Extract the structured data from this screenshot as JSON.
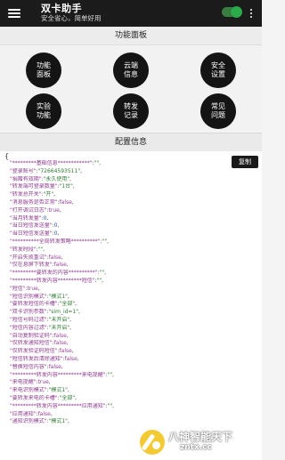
{
  "toolbar": {
    "title": "双卡助手",
    "subtitle": "安全省心，简单好用",
    "toggle_on": true,
    "accent_color": "#2ca94b"
  },
  "panel": {
    "header": "功能面板",
    "buttons": [
      {
        "label": "功能面板"
      },
      {
        "label": "云端信息"
      },
      {
        "label": "安全设置"
      },
      {
        "label": "实验功能"
      },
      {
        "label": "转发记录"
      },
      {
        "label": "常见问题"
      }
    ]
  },
  "config": {
    "header": "配置信息",
    "brace_open": "{",
    "copy_label": "复制",
    "lines": [
      {
        "key": "\"*********基础信息************\"",
        "value": "\"\"",
        "type": "s"
      },
      {
        "key": "\"登录账号\"",
        "value": "\"72664593511\"",
        "type": "s"
      },
      {
        "key": "\"捐赠有效期\"",
        "value": "\"永久使用\"",
        "type": "s"
      },
      {
        "key": "\"转发端可登录数量\"",
        "value": "\"1台\"",
        "type": "s"
      },
      {
        "key": "\"转发总开关\"",
        "value": "\"开\"",
        "type": "s"
      },
      {
        "key": "\"消息服务是否正常\"",
        "value": "false",
        "type": "b"
      },
      {
        "key": "\"打开调试日志\"",
        "value": "true",
        "type": "b"
      },
      {
        "key": "\"当月转发量\"",
        "value": "0",
        "type": "n"
      },
      {
        "key": "\"当日短信发送量\"",
        "value": "0",
        "type": "n"
      },
      {
        "key": "\"当日短信发送量\"",
        "value": "0",
        "type": "n"
      },
      {
        "key": "\"**********全局转发策略**********\"",
        "value": "\"\"",
        "type": "s"
      },
      {
        "key": "\"转发时段\"",
        "value": "\"\"",
        "type": "s"
      },
      {
        "key": "\"开启失败重试\"",
        "value": "false",
        "type": "b"
      },
      {
        "key": "\"仅在息屏下转发\"",
        "value": "false",
        "type": "b"
      },
      {
        "key": "\"*********要转发的内容**********\"",
        "value": "\"\"",
        "type": "s"
      },
      {
        "key": "\"*********转发内容*********短信\"",
        "value": "\"\"",
        "type": "s"
      },
      {
        "key": "\"短信\"",
        "value": "true",
        "type": "b"
      },
      {
        "key": "\"短信识别模式\"",
        "value": "\"模式1\"",
        "type": "s"
      },
      {
        "key": "\"要转发短信的卡槽\"",
        "value": "\"全部\"",
        "type": "s"
      },
      {
        "key": "\"双卡识别参数\"",
        "value": "\"sim_id=1\"",
        "type": "s"
      },
      {
        "key": "\"短信号码过滤\"",
        "value": "\"未开启\"",
        "type": "s"
      },
      {
        "key": "\"短信内容过滤\"",
        "value": "\"未开启\"",
        "type": "s"
      },
      {
        "key": "\"自动复制验证码\"",
        "value": "false",
        "type": "b"
      },
      {
        "key": "\"仅转发通知短信\"",
        "value": "false",
        "type": "b"
      },
      {
        "key": "\"仅转发验证码短信\"",
        "value": "false",
        "type": "b"
      },
      {
        "key": "\"短信转发后清除通知\"",
        "value": "false",
        "type": "b"
      },
      {
        "key": "\"替换短信内容\"",
        "value": "false",
        "type": "b"
      },
      {
        "key": "\"*********转发内容*********来电提醒\"",
        "value": "\"\"",
        "type": "s"
      },
      {
        "key": "\"来电提醒\"",
        "value": "true",
        "type": "b"
      },
      {
        "key": "\"来电识别模式\"",
        "value": "\"模式1\"",
        "type": "s"
      },
      {
        "key": "\"要转发来电的卡槽\"",
        "value": "\"全部\"",
        "type": "s"
      },
      {
        "key": "\"*********转发内容*********应用通知\"",
        "value": "\"\"",
        "type": "s"
      },
      {
        "key": "\"应用通知\"",
        "value": "false",
        "type": "b"
      },
      {
        "key": "\"通知识别模式\"",
        "value": "\"模式1\"",
        "type": "s"
      }
    ]
  },
  "watermark": {
    "title": "八神智能天下",
    "url": "zntx.cc"
  }
}
